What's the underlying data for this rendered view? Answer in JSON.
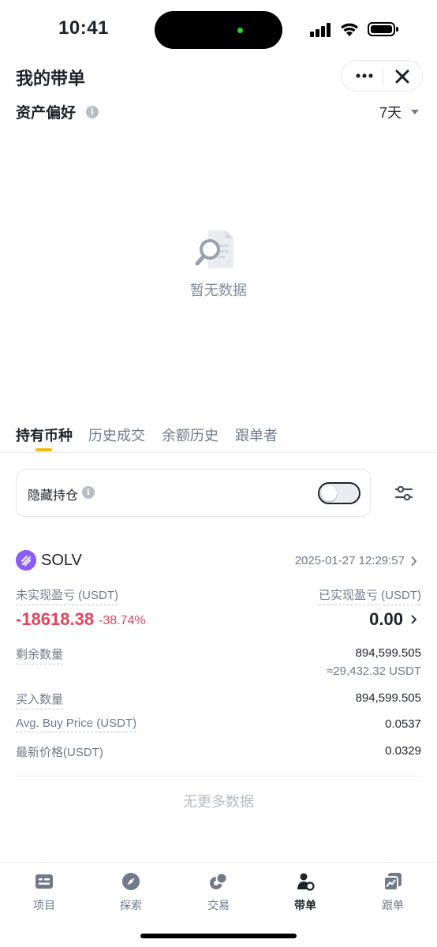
{
  "status_bar": {
    "time": "10:41"
  },
  "header": {
    "title": "我的带单"
  },
  "asset_preference": {
    "title": "资产偏好",
    "period": "7天"
  },
  "empty_state": {
    "text": "暂无数据"
  },
  "tabs": [
    {
      "label": "持有币种",
      "active": true
    },
    {
      "label": "历史成交",
      "active": false
    },
    {
      "label": "余额历史",
      "active": false
    },
    {
      "label": "跟单者",
      "active": false
    }
  ],
  "hide_positions": {
    "label": "隐藏持仓",
    "enabled": false
  },
  "position": {
    "coin": "SOLV",
    "timestamp": "2025-01-27 12:29:57",
    "unrealized_label": "未实现盈亏 (USDT)",
    "unrealized_value": "-18618.38",
    "unrealized_pct": "-38.74%",
    "realized_label": "已实现盈亏 (USDT)",
    "realized_value": "0.00",
    "remaining_label": "剩余数量",
    "remaining_value": "894,599.505",
    "remaining_usdt": "≈29,432.32 USDT",
    "bought_label": "买入数量",
    "bought_value": "894,599.505",
    "avg_price_label": "Avg. Buy Price (USDT)",
    "avg_price_value": "0.0537",
    "latest_price_label": "最新价格(USDT)",
    "latest_price_value": "0.0329"
  },
  "no_more": "无更多数据",
  "tabbar": [
    {
      "label": "项目",
      "icon": "projects-icon",
      "active": false
    },
    {
      "label": "探索",
      "icon": "compass-icon",
      "active": false
    },
    {
      "label": "交易",
      "icon": "trade-icon",
      "active": false
    },
    {
      "label": "带单",
      "icon": "lead-trader-icon",
      "active": true
    },
    {
      "label": "跟单",
      "icon": "copy-trade-icon",
      "active": false
    }
  ],
  "colors": {
    "negative": "#e2445c",
    "accent": "#f0b90b",
    "coin": "#8b5cf6"
  }
}
